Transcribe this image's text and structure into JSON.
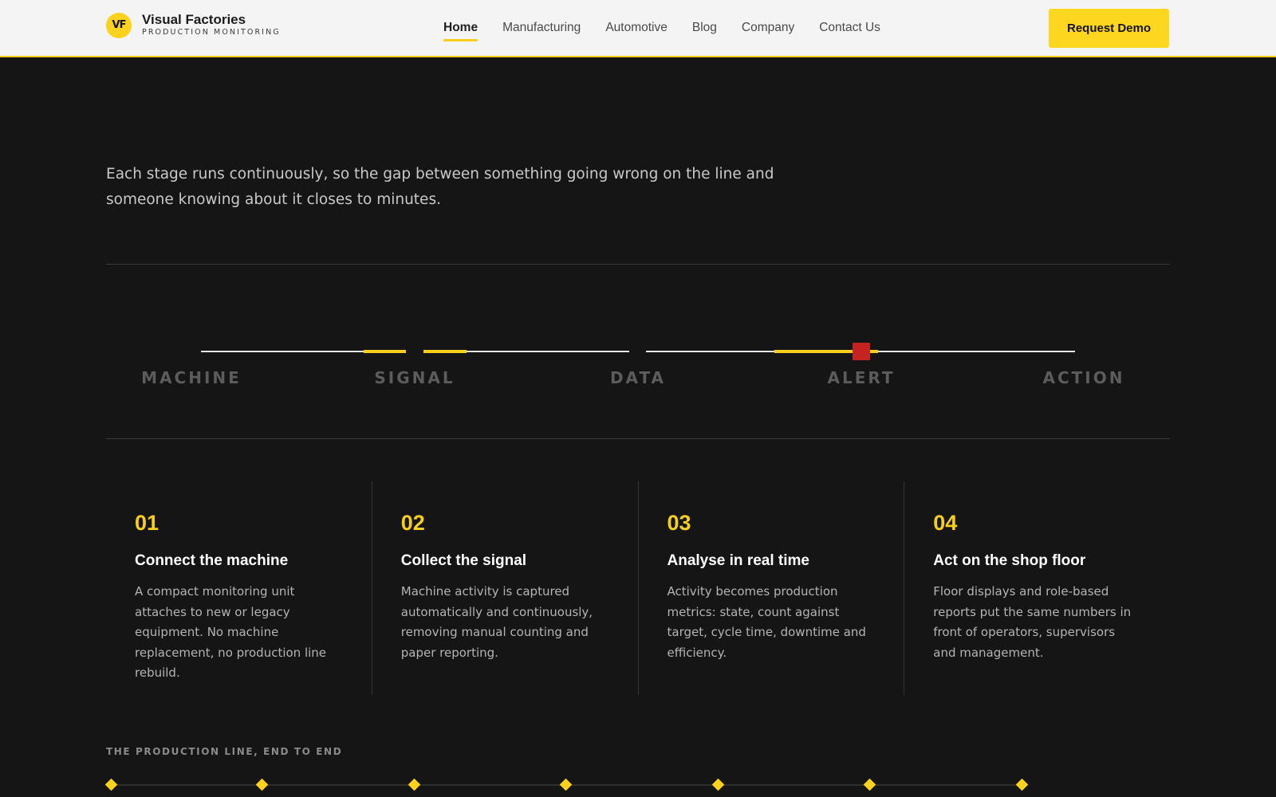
{
  "brand": {
    "logo_mark": "VF",
    "name": "Visual Factories",
    "tagline": "PRODUCTION MONITORING"
  },
  "nav": {
    "items": [
      {
        "label": "Home",
        "active": true
      },
      {
        "label": "Manufacturing",
        "active": false
      },
      {
        "label": "Automotive",
        "active": false
      },
      {
        "label": "Blog",
        "active": false
      },
      {
        "label": "Company",
        "active": false
      },
      {
        "label": "Contact Us",
        "active": false
      }
    ],
    "cta_label": "Request Demo"
  },
  "intro": {
    "text": "Each stage runs continuously, so the gap between something going wrong on the line and someone knowing about it closes to minutes."
  },
  "pipeline": {
    "stages": [
      "MACHINE",
      "SIGNAL",
      "DATA",
      "ALERT",
      "ACTION"
    ],
    "colors": {
      "track": "#e8e8e8",
      "accent": "#f5cf1c",
      "alert": "#c62222",
      "label": "#5c5c5c"
    }
  },
  "steps": [
    {
      "number": "01",
      "title": "Connect the machine",
      "body": "A compact monitoring unit attaches to new or legacy equipment. No machine replacement, no production line rebuild."
    },
    {
      "number": "02",
      "title": "Collect the signal",
      "body": "Machine activity is captured automatically and continuously, removing manual counting and paper reporting."
    },
    {
      "number": "03",
      "title": "Analyse in real time",
      "body": "Activity becomes production metrics: state, count against target, cycle time, downtime and efficiency."
    },
    {
      "number": "04",
      "title": "Act on the shop floor",
      "body": "Floor displays and role-based reports put the same numbers in front of operators, supervisors and management."
    }
  ],
  "production_line": {
    "label": "THE PRODUCTION LINE, END TO END",
    "node_color": "#fcd21c"
  },
  "theme": {
    "accent": "#fcd21c",
    "background": "#151515",
    "header_bg": "#f4f4f4"
  }
}
